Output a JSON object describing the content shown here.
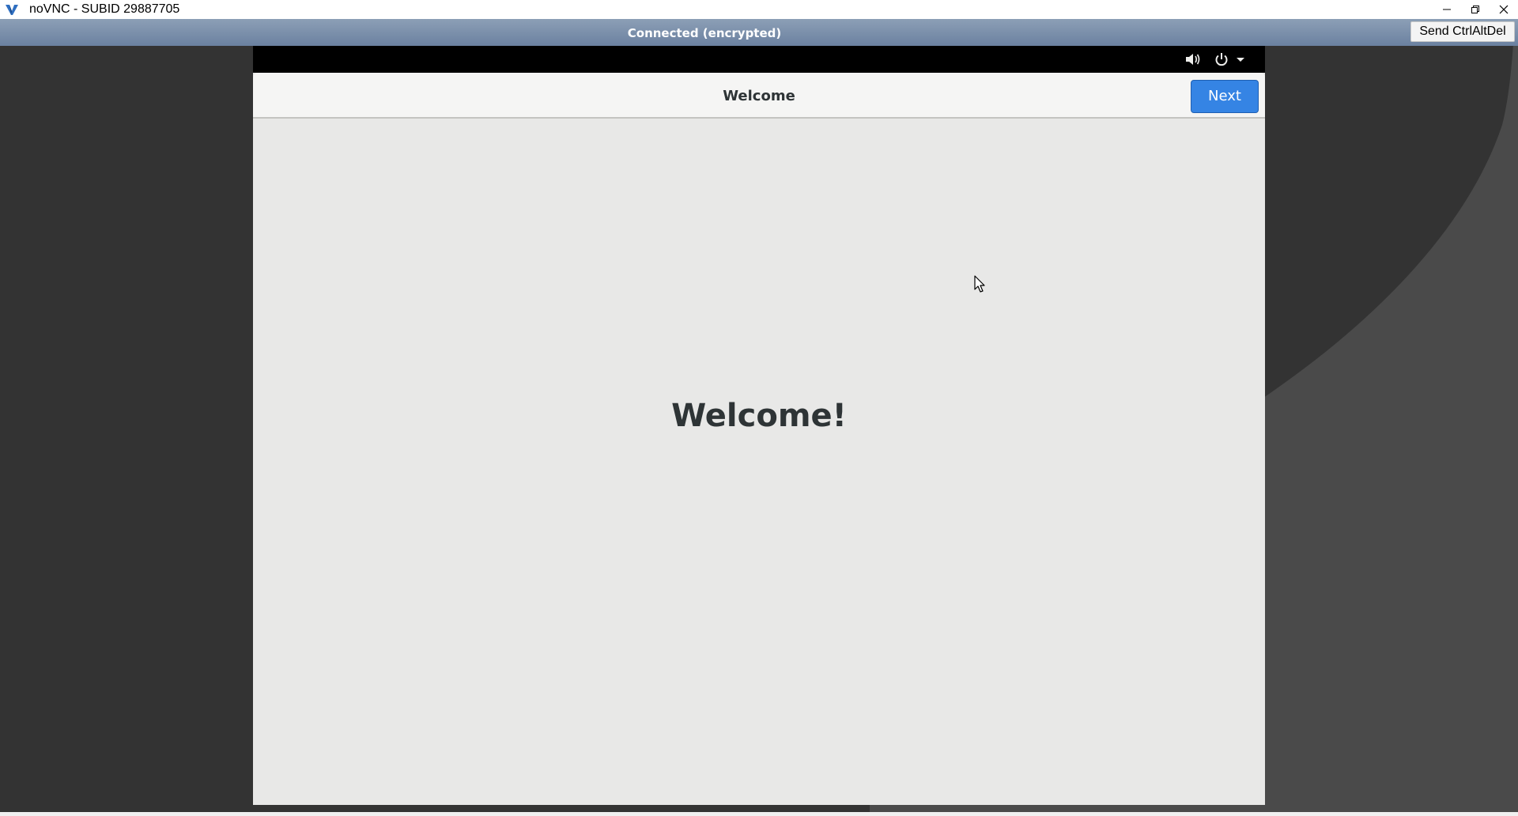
{
  "window": {
    "title": "noVNC - SUBID 29887705",
    "controls": {
      "minimize": "minimize-icon",
      "restore": "restore-icon",
      "close": "close-icon"
    }
  },
  "vnc": {
    "status": "Connected (encrypted)",
    "ctrl_alt_del_label": "Send CtrlAltDel"
  },
  "remote": {
    "topbar_icons": [
      "volume-icon",
      "power-icon",
      "menu-arrow-icon"
    ],
    "header_title": "Welcome",
    "next_label": "Next",
    "heading": "Welcome!"
  },
  "colors": {
    "accent_button": "#3584e4",
    "status_bar": "#7a8fab",
    "desktop_bg": "#333333",
    "window_bg": "#e8e8e7"
  }
}
